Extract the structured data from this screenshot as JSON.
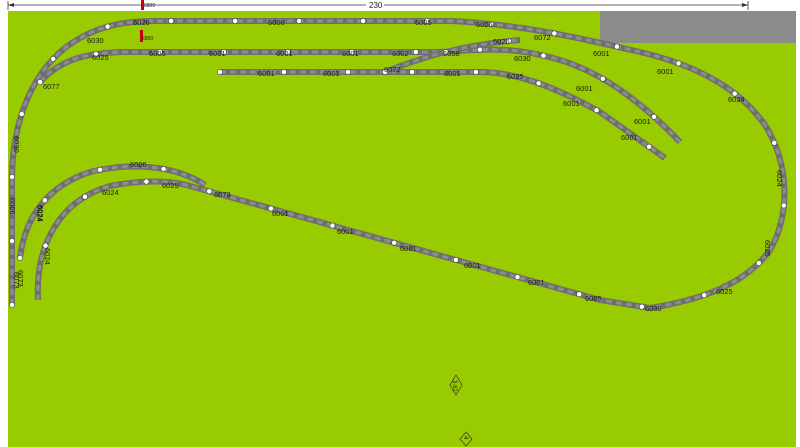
{
  "colors": {
    "board": "#99cc00",
    "blocked_area": "#8c8c8c",
    "track": "#6e6e6e",
    "track_edge": "#8c8c8c",
    "joint": "#ffffff"
  },
  "dimension": {
    "width_label": "230"
  },
  "markers": {
    "marker_a": "3.81",
    "marker_b": "4"
  },
  "labels": [
    {
      "id": "l1",
      "text": "6026"
    },
    {
      "id": "l2",
      "text": "6006"
    },
    {
      "id": "l3",
      "text": "6005"
    },
    {
      "id": "l4",
      "text": "6026"
    },
    {
      "id": "l5",
      "text": "6072"
    },
    {
      "id": "l6",
      "text": "6001"
    },
    {
      "id": "l7",
      "text": "6001"
    },
    {
      "id": "l8",
      "text": "6024"
    },
    {
      "id": "l9",
      "text": "6030"
    },
    {
      "id": "l10",
      "text": "6025"
    },
    {
      "id": "l11",
      "text": "6005"
    },
    {
      "id": "l12",
      "text": "6001"
    },
    {
      "id": "l13",
      "text": "6001"
    },
    {
      "id": "l14",
      "text": "6001"
    },
    {
      "id": "l15",
      "text": "6002"
    },
    {
      "id": "l16",
      "text": "6058"
    },
    {
      "id": "l17",
      "text": "6026"
    },
    {
      "id": "l18",
      "text": "6030"
    },
    {
      "id": "l19",
      "text": "6001"
    },
    {
      "id": "l20",
      "text": "6001"
    },
    {
      "id": "l21",
      "text": "6072"
    },
    {
      "id": "l22",
      "text": "6001"
    },
    {
      "id": "l23",
      "text": "6025"
    },
    {
      "id": "l24",
      "text": "6001"
    },
    {
      "id": "l25",
      "text": "6001"
    },
    {
      "id": "l26",
      "text": "6001"
    },
    {
      "id": "l27",
      "text": "6001"
    },
    {
      "id": "l28",
      "text": "6077"
    },
    {
      "id": "l29",
      "text": "6030"
    },
    {
      "id": "l30",
      "text": "6006"
    },
    {
      "id": "l31",
      "text": "6024"
    },
    {
      "id": "l32",
      "text": "6073"
    },
    {
      "id": "l33",
      "text": "6006"
    },
    {
      "id": "l34",
      "text": "6024"
    },
    {
      "id": "l35",
      "text": "6025"
    },
    {
      "id": "l36",
      "text": "6073"
    },
    {
      "id": "l37",
      "text": "6001"
    },
    {
      "id": "l38",
      "text": "6001"
    },
    {
      "id": "l39",
      "text": "6001"
    },
    {
      "id": "l40",
      "text": "6001"
    },
    {
      "id": "l41",
      "text": "6001"
    },
    {
      "id": "l42",
      "text": "6005"
    },
    {
      "id": "l43",
      "text": "6030"
    },
    {
      "id": "l44",
      "text": "6025"
    },
    {
      "id": "l45",
      "text": "6025"
    },
    {
      "id": "l46",
      "text": "6024"
    },
    {
      "id": "l47",
      "text": "6024"
    },
    {
      "id": "l48",
      "text": "6073"
    },
    {
      "id": "l49",
      "text": "6024"
    },
    {
      "id": "l50",
      "text": "6800"
    },
    {
      "id": "l51",
      "text": "6800"
    }
  ]
}
